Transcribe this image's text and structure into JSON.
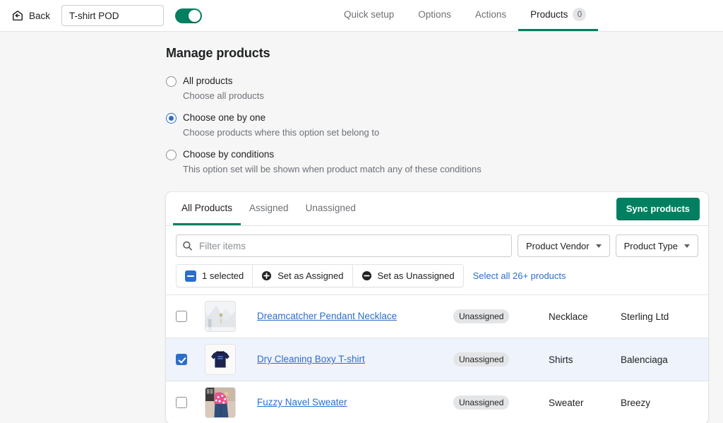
{
  "topbar": {
    "back_label": "Back",
    "back_icon": "back-arrow-box-icon",
    "name_value": "T-shirt POD",
    "name_placeholder": "Option set name",
    "toggle_state": "on",
    "toggle_color": "#008060",
    "tabs": [
      {
        "label": "Quick setup",
        "active": false
      },
      {
        "label": "Options",
        "active": false
      },
      {
        "label": "Actions",
        "active": false
      },
      {
        "label": "Products",
        "active": true,
        "badge": "0"
      }
    ]
  },
  "main": {
    "title": "Manage products",
    "radio_options": [
      {
        "label": "All products",
        "help": "Choose all products",
        "selected": false
      },
      {
        "label": "Choose one by one",
        "help": "Choose products where this option set belong to",
        "selected": true
      },
      {
        "label": "Choose by conditions",
        "help": "This option set will be shown when product match any of these conditions",
        "selected": false
      }
    ]
  },
  "card": {
    "tabs": [
      {
        "label": "All Products",
        "active": true
      },
      {
        "label": "Assigned",
        "active": false
      },
      {
        "label": "Unassigned",
        "active": false
      }
    ],
    "sync_label": "Sync products",
    "filter": {
      "placeholder": "Filter items",
      "value": "",
      "search_icon": "search-icon",
      "vendor_label": "Product Vendor",
      "type_label": "Product Type"
    },
    "bulk": {
      "selected_label": "1 selected",
      "set_assigned_label": "Set as Assigned",
      "set_unassigned_label": "Set as Unassigned",
      "select_all_label": "Select all 26+ products",
      "checkbox_state": "indeterminate",
      "accent_color": "#2c6ecb"
    },
    "rows": [
      {
        "checked": false,
        "thumb": "necklace-thumbnail",
        "name": "Dreamcatcher Pendant Necklace",
        "status": "Unassigned",
        "type": "Necklace",
        "vendor": "Sterling Ltd"
      },
      {
        "checked": true,
        "thumb": "tshirt-thumbnail",
        "name": "Dry Cleaning Boxy T-shirt",
        "status": "Unassigned",
        "type": "Shirts",
        "vendor": "Balenciaga"
      },
      {
        "checked": false,
        "thumb": "sweater-thumbnail",
        "name": "Fuzzy Navel Sweater",
        "status": "Unassigned",
        "type": "Sweater",
        "vendor": "Breezy"
      }
    ]
  }
}
